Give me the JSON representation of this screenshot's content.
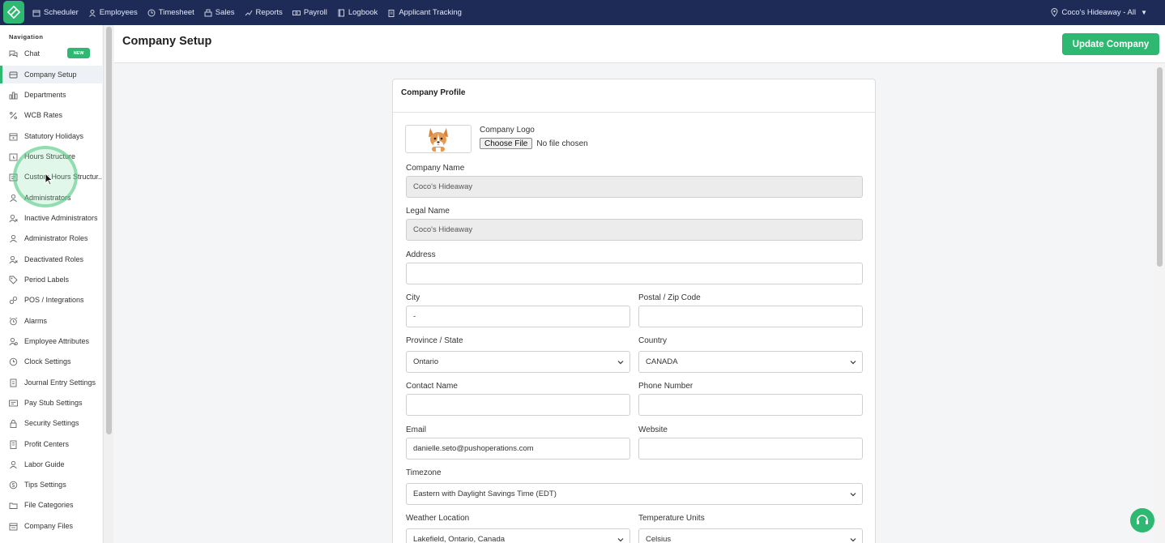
{
  "topbar": {
    "nav": [
      {
        "label": "Scheduler",
        "icon": "calendar-icon"
      },
      {
        "label": "Employees",
        "icon": "person-icon"
      },
      {
        "label": "Timesheet",
        "icon": "clock-icon"
      },
      {
        "label": "Sales",
        "icon": "register-icon"
      },
      {
        "label": "Reports",
        "icon": "chart-icon"
      },
      {
        "label": "Payroll",
        "icon": "money-icon"
      },
      {
        "label": "Logbook",
        "icon": "book-icon"
      },
      {
        "label": "Applicant Tracking",
        "icon": "clipboard-icon"
      }
    ],
    "location": "Coco's Hideaway - All",
    "location_icon": "map-pin-icon",
    "location_caret_icon": "caret-down-icon"
  },
  "sidebar": {
    "heading": "Navigation",
    "items": [
      {
        "label": "Chat",
        "icon": "chat-icon",
        "badge": "NEW"
      },
      {
        "label": "Company Setup",
        "icon": "building-icon",
        "active": true
      },
      {
        "label": "Departments",
        "icon": "departments-icon"
      },
      {
        "label": "WCB Rates",
        "icon": "percent-icon"
      },
      {
        "label": "Statutory Holidays",
        "icon": "holiday-icon"
      },
      {
        "label": "Hours Structure",
        "icon": "hours-icon"
      },
      {
        "label": "Custom Hours Structur...",
        "icon": "custom-hours-icon"
      },
      {
        "label": "Administrators",
        "icon": "person-icon"
      },
      {
        "label": "Inactive Administrators",
        "icon": "person-x-icon"
      },
      {
        "label": "Administrator Roles",
        "icon": "person-icon"
      },
      {
        "label": "Deactivated Roles",
        "icon": "person-x-icon"
      },
      {
        "label": "Period Labels",
        "icon": "tag-icon"
      },
      {
        "label": "POS / Integrations",
        "icon": "link-icon"
      },
      {
        "label": "Alarms",
        "icon": "alarm-icon"
      },
      {
        "label": "Employee Attributes",
        "icon": "person-gear-icon"
      },
      {
        "label": "Clock Settings",
        "icon": "clock-icon"
      },
      {
        "label": "Journal Entry Settings",
        "icon": "journal-icon"
      },
      {
        "label": "Pay Stub Settings",
        "icon": "paystub-icon"
      },
      {
        "label": "Security Settings",
        "icon": "lock-icon"
      },
      {
        "label": "Profit Centers",
        "icon": "building-icon"
      },
      {
        "label": "Labor Guide",
        "icon": "person-icon"
      },
      {
        "label": "Tips Settings",
        "icon": "tips-icon"
      },
      {
        "label": "File Categories",
        "icon": "folders-icon"
      },
      {
        "label": "Company Files",
        "icon": "file-icon"
      }
    ]
  },
  "page": {
    "title": "Company Setup",
    "update_button": "Update Company"
  },
  "card": {
    "title": "Company Profile",
    "logo_label": "Company Logo",
    "logo_image": "corgi-logo-icon",
    "choose_file": "Choose File",
    "file_status": "No file chosen"
  },
  "form": {
    "company_name": {
      "label": "Company Name",
      "value": "Coco's Hideaway"
    },
    "legal_name": {
      "label": "Legal Name",
      "value": "Coco's Hideaway"
    },
    "address": {
      "label": "Address",
      "value": ""
    },
    "city": {
      "label": "City",
      "value": "-"
    },
    "postal": {
      "label": "Postal / Zip Code",
      "value": ""
    },
    "province": {
      "label": "Province / State",
      "value": "Ontario"
    },
    "country": {
      "label": "Country",
      "value": "CANADA"
    },
    "contact_name": {
      "label": "Contact Name",
      "value": ""
    },
    "phone": {
      "label": "Phone Number",
      "value": ""
    },
    "email": {
      "label": "Email",
      "value": "danielle.seto@pushoperations.com"
    },
    "website": {
      "label": "Website",
      "value": ""
    },
    "timezone": {
      "label": "Timezone",
      "value": "Eastern with Daylight Savings Time (EDT)"
    },
    "weather": {
      "label": "Weather Location",
      "value": "Lakefield, Ontario, Canada"
    },
    "temperature": {
      "label": "Temperature Units",
      "value": "Celsius"
    }
  },
  "help": {
    "icon": "help-icon"
  },
  "colors": {
    "topbar": "#1f2b57",
    "accent": "#2eb872",
    "page_bg": "#f4f5f7"
  }
}
